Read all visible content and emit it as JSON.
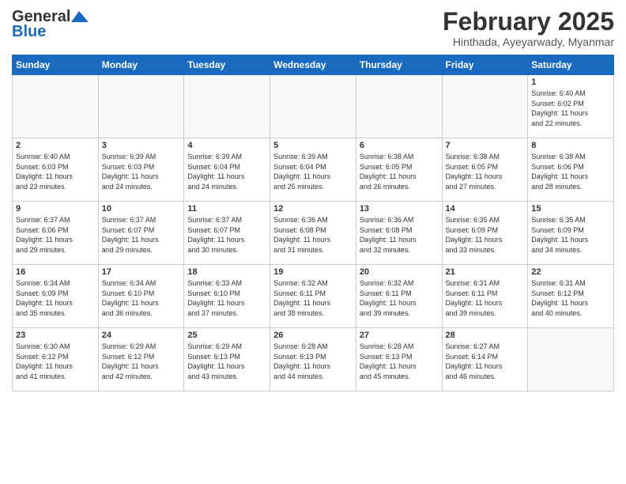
{
  "logo": {
    "line1": "General",
    "line2": "Blue"
  },
  "title": "February 2025",
  "subtitle": "Hinthada, Ayeyarwady, Myanmar",
  "days_of_week": [
    "Sunday",
    "Monday",
    "Tuesday",
    "Wednesday",
    "Thursday",
    "Friday",
    "Saturday"
  ],
  "weeks": [
    [
      {
        "day": "",
        "info": ""
      },
      {
        "day": "",
        "info": ""
      },
      {
        "day": "",
        "info": ""
      },
      {
        "day": "",
        "info": ""
      },
      {
        "day": "",
        "info": ""
      },
      {
        "day": "",
        "info": ""
      },
      {
        "day": "1",
        "info": "Sunrise: 6:40 AM\nSunset: 6:02 PM\nDaylight: 11 hours\nand 22 minutes."
      }
    ],
    [
      {
        "day": "2",
        "info": "Sunrise: 6:40 AM\nSunset: 6:03 PM\nDaylight: 11 hours\nand 23 minutes."
      },
      {
        "day": "3",
        "info": "Sunrise: 6:39 AM\nSunset: 6:03 PM\nDaylight: 11 hours\nand 24 minutes."
      },
      {
        "day": "4",
        "info": "Sunrise: 6:39 AM\nSunset: 6:04 PM\nDaylight: 11 hours\nand 24 minutes."
      },
      {
        "day": "5",
        "info": "Sunrise: 6:39 AM\nSunset: 6:04 PM\nDaylight: 11 hours\nand 25 minutes."
      },
      {
        "day": "6",
        "info": "Sunrise: 6:38 AM\nSunset: 6:05 PM\nDaylight: 11 hours\nand 26 minutes."
      },
      {
        "day": "7",
        "info": "Sunrise: 6:38 AM\nSunset: 6:05 PM\nDaylight: 11 hours\nand 27 minutes."
      },
      {
        "day": "8",
        "info": "Sunrise: 6:38 AM\nSunset: 6:06 PM\nDaylight: 11 hours\nand 28 minutes."
      }
    ],
    [
      {
        "day": "9",
        "info": "Sunrise: 6:37 AM\nSunset: 6:06 PM\nDaylight: 11 hours\nand 29 minutes."
      },
      {
        "day": "10",
        "info": "Sunrise: 6:37 AM\nSunset: 6:07 PM\nDaylight: 11 hours\nand 29 minutes."
      },
      {
        "day": "11",
        "info": "Sunrise: 6:37 AM\nSunset: 6:07 PM\nDaylight: 11 hours\nand 30 minutes."
      },
      {
        "day": "12",
        "info": "Sunrise: 6:36 AM\nSunset: 6:08 PM\nDaylight: 11 hours\nand 31 minutes."
      },
      {
        "day": "13",
        "info": "Sunrise: 6:36 AM\nSunset: 6:08 PM\nDaylight: 11 hours\nand 32 minutes."
      },
      {
        "day": "14",
        "info": "Sunrise: 6:35 AM\nSunset: 6:09 PM\nDaylight: 11 hours\nand 33 minutes."
      },
      {
        "day": "15",
        "info": "Sunrise: 6:35 AM\nSunset: 6:09 PM\nDaylight: 11 hours\nand 34 minutes."
      }
    ],
    [
      {
        "day": "16",
        "info": "Sunrise: 6:34 AM\nSunset: 6:09 PM\nDaylight: 11 hours\nand 35 minutes."
      },
      {
        "day": "17",
        "info": "Sunrise: 6:34 AM\nSunset: 6:10 PM\nDaylight: 11 hours\nand 36 minutes."
      },
      {
        "day": "18",
        "info": "Sunrise: 6:33 AM\nSunset: 6:10 PM\nDaylight: 11 hours\nand 37 minutes."
      },
      {
        "day": "19",
        "info": "Sunrise: 6:32 AM\nSunset: 6:11 PM\nDaylight: 11 hours\nand 38 minutes."
      },
      {
        "day": "20",
        "info": "Sunrise: 6:32 AM\nSunset: 6:11 PM\nDaylight: 11 hours\nand 39 minutes."
      },
      {
        "day": "21",
        "info": "Sunrise: 6:31 AM\nSunset: 6:11 PM\nDaylight: 11 hours\nand 39 minutes."
      },
      {
        "day": "22",
        "info": "Sunrise: 6:31 AM\nSunset: 6:12 PM\nDaylight: 11 hours\nand 40 minutes."
      }
    ],
    [
      {
        "day": "23",
        "info": "Sunrise: 6:30 AM\nSunset: 6:12 PM\nDaylight: 11 hours\nand 41 minutes."
      },
      {
        "day": "24",
        "info": "Sunrise: 6:29 AM\nSunset: 6:12 PM\nDaylight: 11 hours\nand 42 minutes."
      },
      {
        "day": "25",
        "info": "Sunrise: 6:29 AM\nSunset: 6:13 PM\nDaylight: 11 hours\nand 43 minutes."
      },
      {
        "day": "26",
        "info": "Sunrise: 6:28 AM\nSunset: 6:13 PM\nDaylight: 11 hours\nand 44 minutes."
      },
      {
        "day": "27",
        "info": "Sunrise: 6:28 AM\nSunset: 6:13 PM\nDaylight: 11 hours\nand 45 minutes."
      },
      {
        "day": "28",
        "info": "Sunrise: 6:27 AM\nSunset: 6:14 PM\nDaylight: 11 hours\nand 46 minutes."
      },
      {
        "day": "",
        "info": ""
      }
    ]
  ]
}
